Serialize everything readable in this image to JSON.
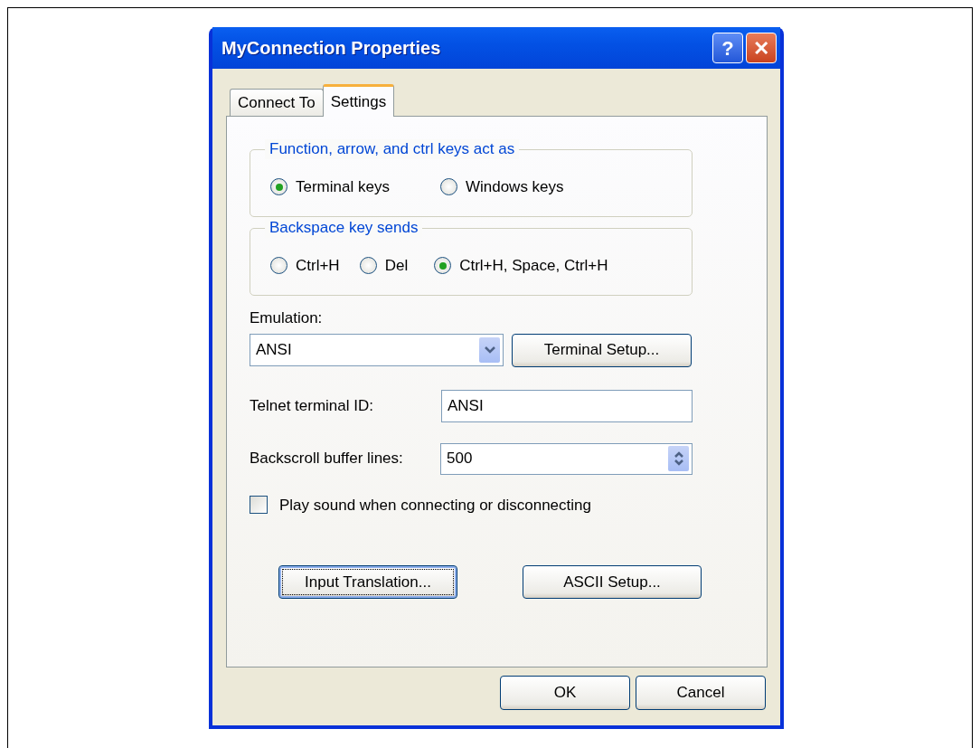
{
  "window": {
    "title": "MyConnection Properties",
    "help_button": "?",
    "close_button": "✕"
  },
  "tabs": [
    {
      "label": "Connect To",
      "selected": false
    },
    {
      "label": "Settings",
      "selected": true
    }
  ],
  "groups": [
    {
      "title": "Function, arrow, and ctrl keys act as",
      "options": [
        {
          "label": "Terminal keys",
          "selected": true
        },
        {
          "label": "Windows keys",
          "selected": false
        }
      ]
    },
    {
      "title": "Backspace key sends",
      "options": [
        {
          "label": "Ctrl+H",
          "selected": false
        },
        {
          "label": "Del",
          "selected": false
        },
        {
          "label": "Ctrl+H, Space, Ctrl+H",
          "selected": true
        }
      ]
    }
  ],
  "emulation": {
    "label": "Emulation:",
    "value": "ANSI",
    "button": "Terminal Setup..."
  },
  "telnet_id": {
    "label": "Telnet terminal ID:",
    "value": "ANSI"
  },
  "backscroll": {
    "label": "Backscroll buffer lines:",
    "value": "500"
  },
  "play_sound": {
    "label": "Play sound when connecting or disconnecting",
    "checked": false
  },
  "setup_buttons": [
    {
      "label": "Input Translation...",
      "focused": true
    },
    {
      "label": "ASCII Setup...",
      "focused": false
    }
  ],
  "buttons": [
    "OK",
    "Cancel"
  ]
}
